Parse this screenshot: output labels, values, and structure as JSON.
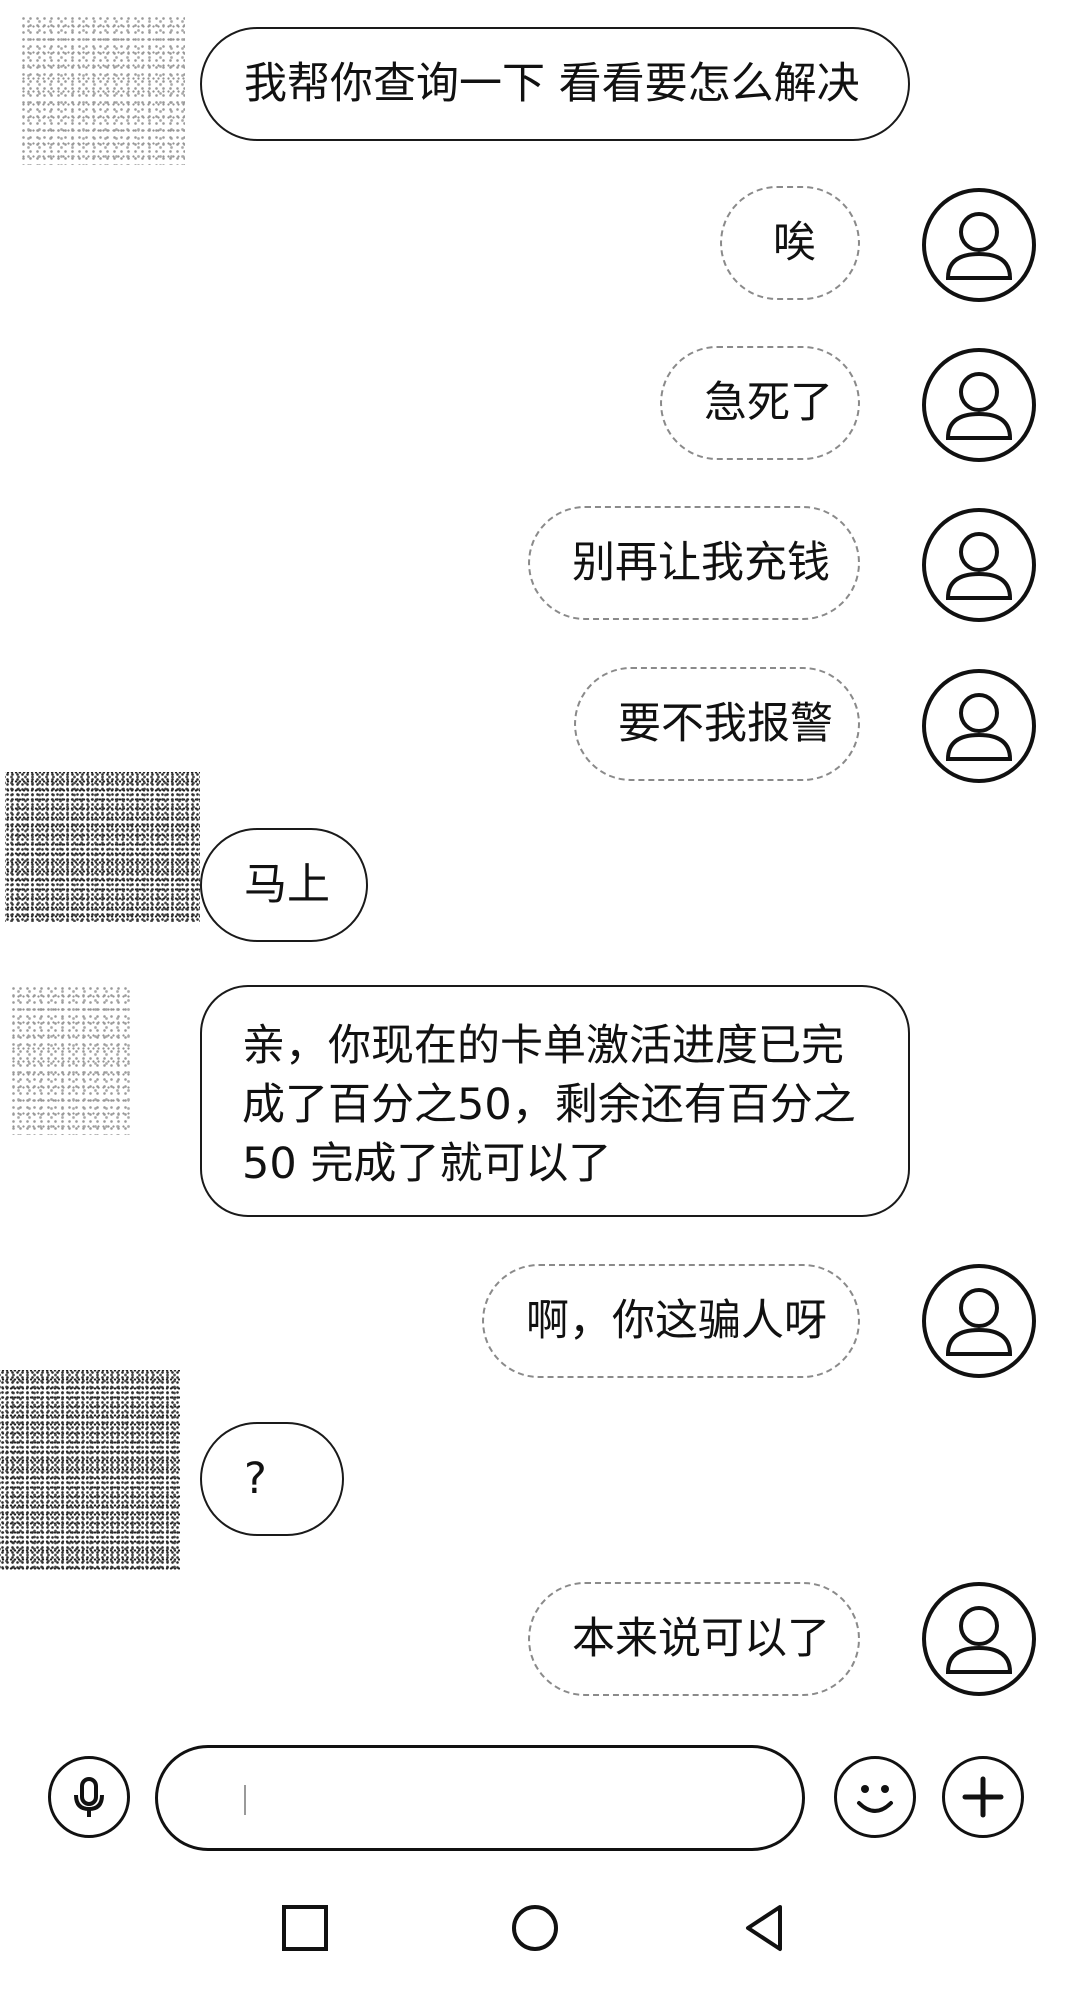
{
  "messages": [
    {
      "side": "other",
      "text": "我帮你查询一下 看看要怎么解决"
    },
    {
      "side": "self",
      "text": "唉"
    },
    {
      "side": "self",
      "text": "急死了"
    },
    {
      "side": "self",
      "text": "别再让我充钱"
    },
    {
      "side": "self",
      "text": "要不我报警"
    },
    {
      "side": "other",
      "text": "马上"
    },
    {
      "side": "other",
      "lines": [
        "亲，你现在的卡单激活进度已完",
        "成了百分之50，剩余还有百分之",
        "50 完成了就可以了"
      ]
    },
    {
      "side": "self",
      "text": "啊，你这骗人呀"
    },
    {
      "side": "other",
      "text": "?"
    },
    {
      "side": "self",
      "text": "本来说可以了"
    }
  ],
  "input_bar": {
    "voice_icon": "microphone-icon",
    "text_value": "",
    "emoji_icon": "smiley-icon",
    "more_icon": "plus-icon"
  },
  "nav_bar": {
    "recents_icon": "square-icon",
    "home_icon": "circle-icon",
    "back_icon": "triangle-back-icon"
  }
}
